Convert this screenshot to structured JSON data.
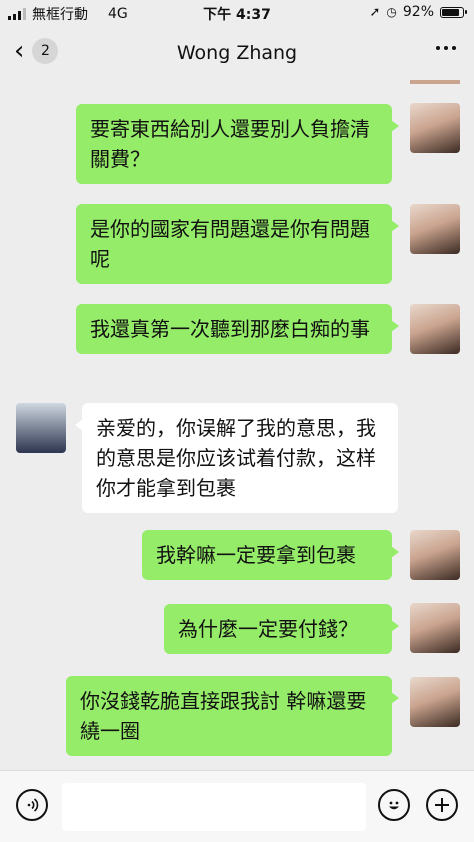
{
  "status_bar": {
    "carrier": "無框行動",
    "network": "4G",
    "time": "下午 4:37",
    "battery": "92%",
    "battery_level": 0.92
  },
  "header": {
    "unread_count": "2",
    "title": "Wong Zhang"
  },
  "messages": [
    {
      "sender": "me",
      "text": "要寄東西給別人還要別人負擔清關費？"
    },
    {
      "sender": "me",
      "text": "是你的國家有問題還是你有問題呢"
    },
    {
      "sender": "me",
      "text": "我還真第一次聽到那麼白痴的事"
    },
    {
      "sender": "them",
      "text": "亲爱的，你误解了我的意思，我的意思是你应该试着付款，这样你才能拿到包裹"
    },
    {
      "sender": "me",
      "text": "我幹嘛一定要拿到包裹"
    },
    {
      "sender": "me",
      "text": "為什麼一定要付錢？"
    },
    {
      "sender": "me",
      "text": "你沒錢乾脆直接跟我討  幹嘛還要繞一圈"
    }
  ],
  "input": {
    "placeholder": ""
  },
  "icons": {
    "voice": "voice-icon",
    "emoji": "emoji-icon",
    "plus": "plus-icon"
  },
  "colors": {
    "my_bubble": "#95ec69",
    "their_bubble": "#ffffff",
    "background": "#ededed"
  }
}
